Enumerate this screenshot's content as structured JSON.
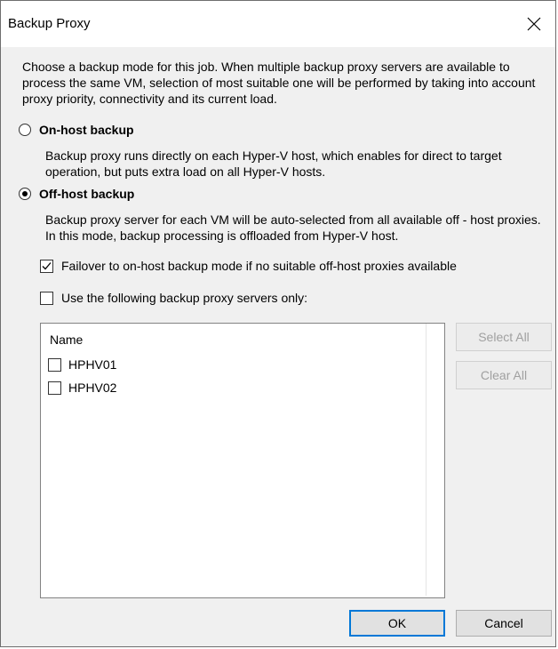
{
  "dialog": {
    "title": "Backup Proxy",
    "description": "Choose a backup mode for this job. When multiple backup proxy servers are available to process the same VM, selection of most suitable one will be performed by taking into account proxy priority, connectivity and its current load."
  },
  "modes": {
    "on_host": {
      "label": "On-host backup",
      "selected": false,
      "description": "Backup proxy runs directly on each Hyper-V host, which enables for direct to target operation, but puts extra load on all Hyper-V hosts."
    },
    "off_host": {
      "label": "Off-host backup",
      "selected": true,
      "description": "Backup proxy server for each VM will be auto-selected from all available off - host proxies. In this mode, backup processing is offloaded from Hyper-V host."
    }
  },
  "options": {
    "failover": {
      "label": "Failover to on-host backup mode if no suitable off-host proxies available",
      "checked": true
    },
    "use_following": {
      "label": "Use the following backup proxy servers only:",
      "checked": false
    }
  },
  "proxy_list": {
    "column_header": "Name",
    "items": [
      {
        "name": "HPHV01",
        "checked": false
      },
      {
        "name": "HPHV02",
        "checked": false
      }
    ]
  },
  "side_buttons": {
    "select_all": "Select All",
    "clear_all": "Clear All"
  },
  "footer": {
    "ok": "OK",
    "cancel": "Cancel"
  },
  "colors": {
    "focus_border": "#0078d7",
    "disabled_text": "#a0a0a0"
  }
}
